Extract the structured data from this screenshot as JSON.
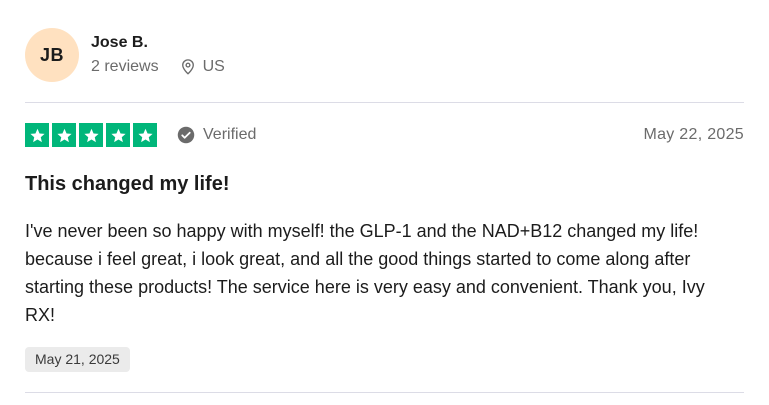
{
  "reviewer": {
    "initials": "JB",
    "name": "Jose B.",
    "reviews_count": "2 reviews",
    "country": "US",
    "avatar_color": "#ffe1c0"
  },
  "rating": {
    "stars": 5,
    "max_stars": 5,
    "star_color": "#00b67a",
    "verified_label": "Verified"
  },
  "review": {
    "date": "May 22, 2025",
    "title": "This changed my life!",
    "body": "I've never been so happy with myself! the GLP-1 and the NAD+B12 changed my life! because i feel great, i look great, and all the good things started to come along after starting these products! The service here is very easy and convenient. Thank you, Ivy RX!",
    "experience_date": "May 21, 2025"
  },
  "icons": {
    "location": "map-pin-icon",
    "verified": "check-circle-icon",
    "star": "star-icon"
  }
}
